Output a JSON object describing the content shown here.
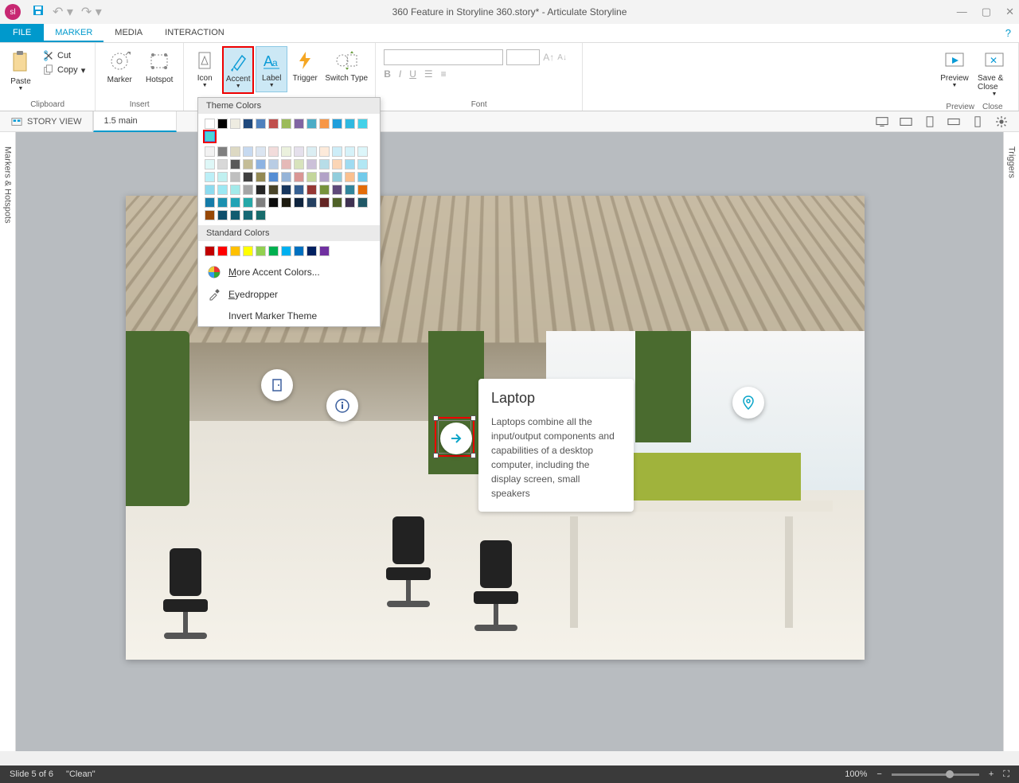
{
  "title": "360 Feature in Storyline 360.story*  -  Articulate Storyline",
  "tabs": {
    "file": "FILE",
    "marker": "MARKER",
    "media": "MEDIA",
    "interaction": "INTERACTION"
  },
  "clipboard": {
    "paste": "Paste",
    "cut": "Cut",
    "copy": "Copy",
    "group": "Clipboard"
  },
  "insert": {
    "marker": "Marker",
    "hotspot": "Hotspot",
    "group": "Insert"
  },
  "markerGroup": {
    "icon": "Icon",
    "accent": "Accent",
    "label": "Label",
    "trigger": "Trigger",
    "switch": "Switch Type"
  },
  "fontGroup": {
    "label": "Font"
  },
  "previewGroup": {
    "preview": "Preview",
    "save_close": "Save & Close",
    "preview_label": "Preview",
    "close_label": "Close"
  },
  "viewRow": {
    "storyView": "STORY VIEW",
    "slideTab": "1.5 main"
  },
  "rails": {
    "left": "Markers & Hotspots",
    "right": "Triggers"
  },
  "colorDropdown": {
    "themeHeader": "Theme Colors",
    "standardHeader": "Standard Colors",
    "more": "More Accent Colors...",
    "eyedropper": "Eyedropper",
    "invert": "Invert Marker Theme",
    "themeRow1": [
      "#ffffff",
      "#000000",
      "#eeece1",
      "#1f497d",
      "#4f81bd",
      "#c0504d",
      "#9bbb59",
      "#8064a2",
      "#4bacc6",
      "#f79646",
      "#1f9edb",
      "#2fb8e0",
      "#42d1e8",
      "#4cd6d6"
    ],
    "themeShades": [
      [
        "#f2f2f2",
        "#7f7f7f",
        "#ddd9c3",
        "#c6d9f0",
        "#dbe5f1",
        "#f2dcdb",
        "#ebf1dd",
        "#e5e0ec",
        "#dbeef3",
        "#fdeada",
        "#cdedf8",
        "#d6f2f9",
        "#dcf6fa",
        "#def7f7"
      ],
      [
        "#d8d8d8",
        "#595959",
        "#c4bd97",
        "#8db3e2",
        "#b8cce4",
        "#e5b9b7",
        "#d7e3bc",
        "#ccc1d9",
        "#b7dde8",
        "#fbd5b5",
        "#9fdbf1",
        "#b1e7f4",
        "#bceff7",
        "#c0f0f0"
      ],
      [
        "#bfbfbf",
        "#3f3f3f",
        "#938953",
        "#548dd4",
        "#95b3d7",
        "#d99694",
        "#c3d69b",
        "#b2a2c7",
        "#92cddc",
        "#fac08f",
        "#71caea",
        "#8ddbef",
        "#9ce8f3",
        "#a3eaea"
      ],
      [
        "#a5a5a5",
        "#262626",
        "#494429",
        "#17365d",
        "#366092",
        "#953734",
        "#76923c",
        "#5f497a",
        "#31859b",
        "#e36c09",
        "#157ba8",
        "#1b90af",
        "#22a3b5",
        "#26a8a8"
      ],
      [
        "#7f7f7f",
        "#0c0c0c",
        "#1d1b10",
        "#0f243e",
        "#244061",
        "#632423",
        "#4f6128",
        "#3f3151",
        "#205867",
        "#974806",
        "#0d4e6b",
        "#115c70",
        "#166874",
        "#186c6c"
      ]
    ],
    "standardRow": [
      "#c00000",
      "#ff0000",
      "#ffc000",
      "#ffff00",
      "#92d050",
      "#00b050",
      "#00b0f0",
      "#0070c0",
      "#002060",
      "#7030a0"
    ],
    "selectedIndex": 13
  },
  "callout": {
    "title": "Laptop",
    "body": "Laptops combine all the input/output components and capabilities of a desktop computer, including the display screen, small speakers"
  },
  "status": {
    "slide": "Slide 5 of 6",
    "layout": "\"Clean\"",
    "zoom": "100%"
  }
}
